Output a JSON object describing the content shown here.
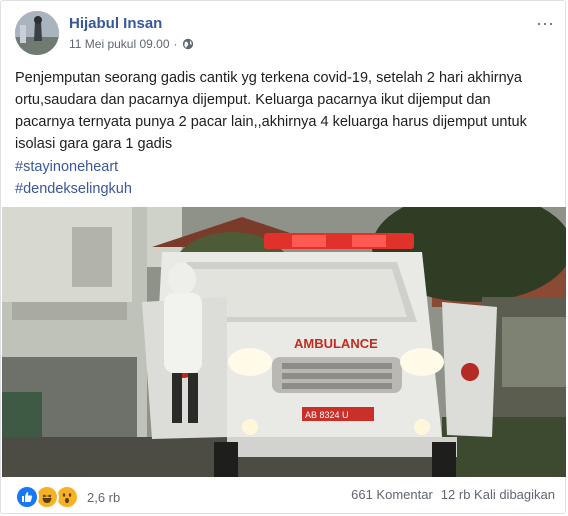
{
  "post": {
    "author": "Hijabul Insan",
    "timestamp": "11 Mei pukul 09.00",
    "privacy_icon": "globe-icon",
    "more_icon": "more-horizontal-icon",
    "text": "Penjemputan seorang gadis cantik yg terkena covid-19, setelah 2 hari akhirnya ortu,saudara dan pacarnya dijemput. Keluarga pacarnya ikut dijemput dan pacarnya ternyata punya 2 pacar lain,,akhirnya 4 keluarga harus dijemput untuk isolasi gara gara 1 gadis",
    "hashtags": [
      "#stayinoneheart",
      "#dendekselingkuh"
    ],
    "photo": {
      "vehicle_label": "AMBULANCE",
      "plate": "AB 8324 U"
    }
  },
  "footer": {
    "reactions": [
      "like-icon",
      "haha-icon",
      "wow-icon"
    ],
    "reaction_count": "2,6 rb",
    "comments": "661 Komentar",
    "shares": "12 rb Kali dibagikan"
  },
  "colors": {
    "link": "#385898",
    "secondary_text": "#606770",
    "like_blue": "#1877f2",
    "reaction_yellow": "#f7b125",
    "ambulance_red": "#e0312b"
  }
}
